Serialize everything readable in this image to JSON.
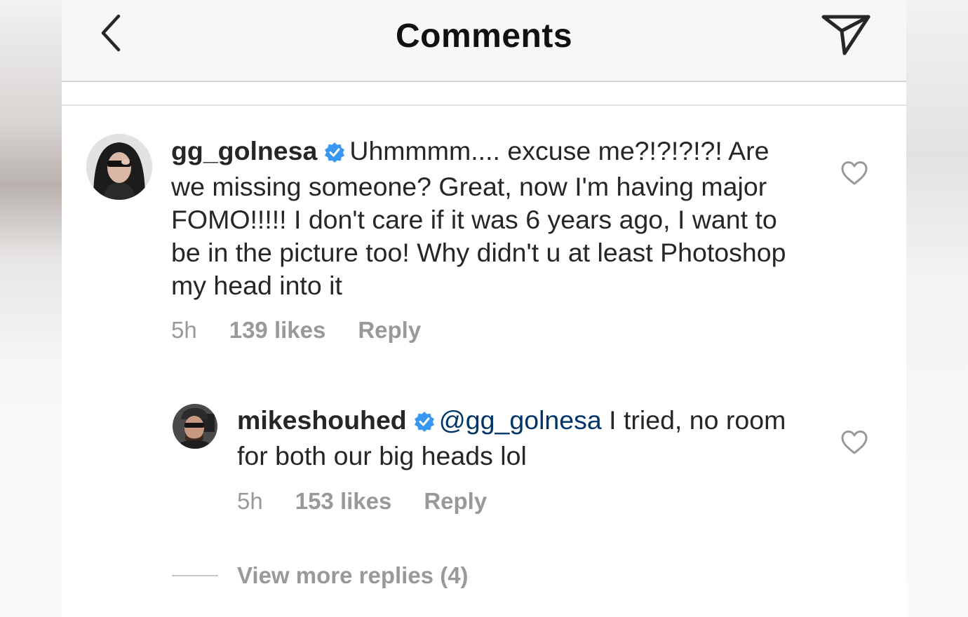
{
  "header": {
    "title": "Comments",
    "back_icon": "chevron-left-icon",
    "share_icon": "paper-plane-icon"
  },
  "comments": [
    {
      "username": "gg_golnesa",
      "verified": true,
      "text": "Uhmmmm.... excuse me?!?!?!?! Are we missing someone? Great, now I'm having major FOMO!!!!! I don't care if it was 6 years ago, I want to be in the picture too! Why didn't u at least Photoshop my head into it",
      "time": "5h",
      "likes": "139 likes",
      "reply_label": "Reply"
    },
    {
      "username": "mikeshouhed",
      "verified": true,
      "mention": "@gg_golnesa",
      "text": "I tried, no room for both our big heads lol",
      "time": "5h",
      "likes": "153 likes",
      "reply_label": "Reply"
    }
  ],
  "view_more_replies": "View more replies (4)",
  "colors": {
    "verified_badge": "#3897f0",
    "mention": "#003569",
    "meta_text": "#999999",
    "primary_text": "#262626"
  }
}
